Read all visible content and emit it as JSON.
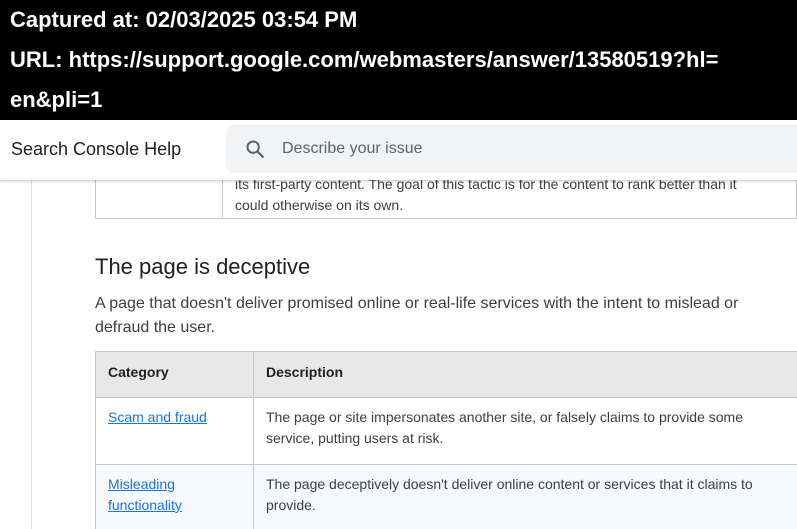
{
  "capture": {
    "captured_line": "Captured at: 02/03/2025 03:54 PM",
    "url_line_1": "URL: https://support.google.com/webmasters/answer/13580519?hl=",
    "url_line_2": "en&pli=1"
  },
  "header": {
    "title": "Search Console Help",
    "search_placeholder": "Describe your issue",
    "search_value": ""
  },
  "previous_table": {
    "desc_line_1": "its first-party content. The goal of this tactic is for the content to rank better than it",
    "desc_line_2": "could otherwise on its own."
  },
  "section": {
    "heading": "The page is deceptive",
    "intro": "A page that doesn't deliver promised online or real-life services with the intent to mislead or defraud the user."
  },
  "category_table": {
    "headers": [
      "Category",
      "Description"
    ],
    "rows": [
      {
        "category": "Scam and fraud",
        "description": "The page or site impersonates another site, or falsely claims to provide some service, putting users at risk."
      },
      {
        "category": "Misleading functionality",
        "description": "The page deceptively doesn't deliver online content or services that it claims to provide."
      }
    ]
  },
  "colors": {
    "link": "#1a73e8",
    "header_bg": "#e8e8e8",
    "border": "#c4c7c5",
    "search_bg": "#f1f3f4"
  },
  "icons": {
    "search": "search-icon"
  }
}
